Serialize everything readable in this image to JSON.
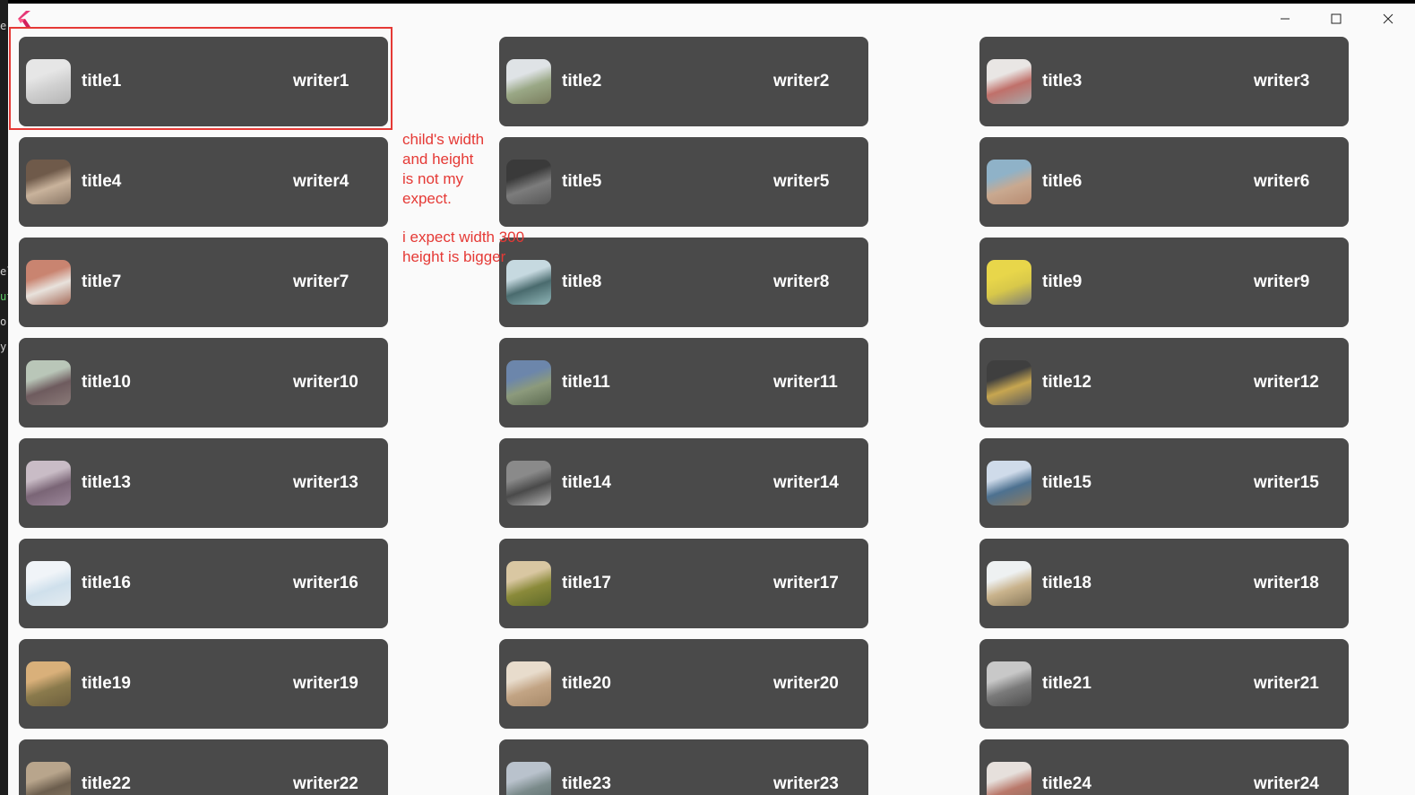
{
  "background_editor_glyphs": [
    "e",
    "el",
    "ut",
    "or",
    "y"
  ],
  "window": {
    "logo_icon": "flutter-logo-icon",
    "controls": {
      "minimize_icon": "minimize-icon",
      "maximize_icon": "maximize-icon",
      "close_icon": "close-icon"
    }
  },
  "cards": [
    {
      "title": "title1",
      "writer": "writer1",
      "thumb": [
        "#e6e6e6",
        "#d0d0d0",
        "#b5b5b5"
      ]
    },
    {
      "title": "title2",
      "writer": "writer2",
      "thumb": [
        "#dfe3e6",
        "#9aa886",
        "#7a7d5e"
      ]
    },
    {
      "title": "title3",
      "writer": "writer3",
      "thumb": [
        "#e9e6e4",
        "#c0706a",
        "#a8a8a8"
      ]
    },
    {
      "title": "title4",
      "writer": "writer4",
      "thumb": [
        "#6f5a4a",
        "#c9b39c",
        "#8a7766"
      ]
    },
    {
      "title": "title5",
      "writer": "writer5",
      "thumb": [
        "#3a3a3a",
        "#7c7c7c",
        "#575757"
      ]
    },
    {
      "title": "title6",
      "writer": "writer6",
      "thumb": [
        "#8fb2c8",
        "#c9a990",
        "#b88c72"
      ]
    },
    {
      "title": "title7",
      "writer": "writer7",
      "thumb": [
        "#c98470",
        "#e8e2dc",
        "#a66c5a"
      ]
    },
    {
      "title": "title8",
      "writer": "writer8",
      "thumb": [
        "#c6d9e0",
        "#4a6b6e",
        "#8fb5b7"
      ]
    },
    {
      "title": "title9",
      "writer": "writer9",
      "thumb": [
        "#e8d64a",
        "#d8c84a",
        "#7c7c78"
      ]
    },
    {
      "title": "title10",
      "writer": "writer10",
      "thumb": [
        "#b9c6b8",
        "#6e5b5e",
        "#8a7a78"
      ]
    },
    {
      "title": "title11",
      "writer": "writer11",
      "thumb": [
        "#6c86ab",
        "#8c9a7c",
        "#5d6b52"
      ]
    },
    {
      "title": "title12",
      "writer": "writer12",
      "thumb": [
        "#3f3f3f",
        "#c7a650",
        "#5c5c5c"
      ]
    },
    {
      "title": "title13",
      "writer": "writer13",
      "thumb": [
        "#c9bcc6",
        "#7a6576",
        "#9a8598"
      ]
    },
    {
      "title": "title14",
      "writer": "writer14",
      "thumb": [
        "#8a8a8a",
        "#4a4a4a",
        "#b0b0b0"
      ]
    },
    {
      "title": "title15",
      "writer": "writer15",
      "thumb": [
        "#cfdbea",
        "#4d7190",
        "#8a7a62"
      ]
    },
    {
      "title": "title16",
      "writer": "writer16",
      "thumb": [
        "#f0f4f8",
        "#cfe0ec",
        "#e4ebf0"
      ]
    },
    {
      "title": "title17",
      "writer": "writer17",
      "thumb": [
        "#d9c7a2",
        "#8a8a3a",
        "#5f6a2a"
      ]
    },
    {
      "title": "title18",
      "writer": "writer18",
      "thumb": [
        "#eef1f2",
        "#c9b38c",
        "#8a7a5c"
      ]
    },
    {
      "title": "title19",
      "writer": "writer19",
      "thumb": [
        "#d9b07a",
        "#8a7a4c",
        "#6e603e"
      ]
    },
    {
      "title": "title20",
      "writer": "writer20",
      "thumb": [
        "#e8dccc",
        "#c2a484",
        "#a88a6a"
      ]
    },
    {
      "title": "title21",
      "writer": "writer21",
      "thumb": [
        "#c8c8c8",
        "#7a7a7a",
        "#4e4e4e"
      ]
    },
    {
      "title": "title22",
      "writer": "writer22",
      "thumb": [
        "#b8a58c",
        "#6c5e4e",
        "#8a7a66"
      ]
    },
    {
      "title": "title23",
      "writer": "writer23",
      "thumb": [
        "#b9c2cc",
        "#7a8a8a",
        "#5a6a6a"
      ]
    },
    {
      "title": "title24",
      "writer": "writer24",
      "thumb": [
        "#e6e0dc",
        "#b9786a",
        "#8a6a5a"
      ]
    }
  ],
  "annotation": {
    "note1": [
      "child's width",
      "and height",
      "is not my",
      "expect."
    ],
    "note2": [
      "i expect width 300",
      "height is bigger"
    ],
    "color": "#e53935"
  }
}
